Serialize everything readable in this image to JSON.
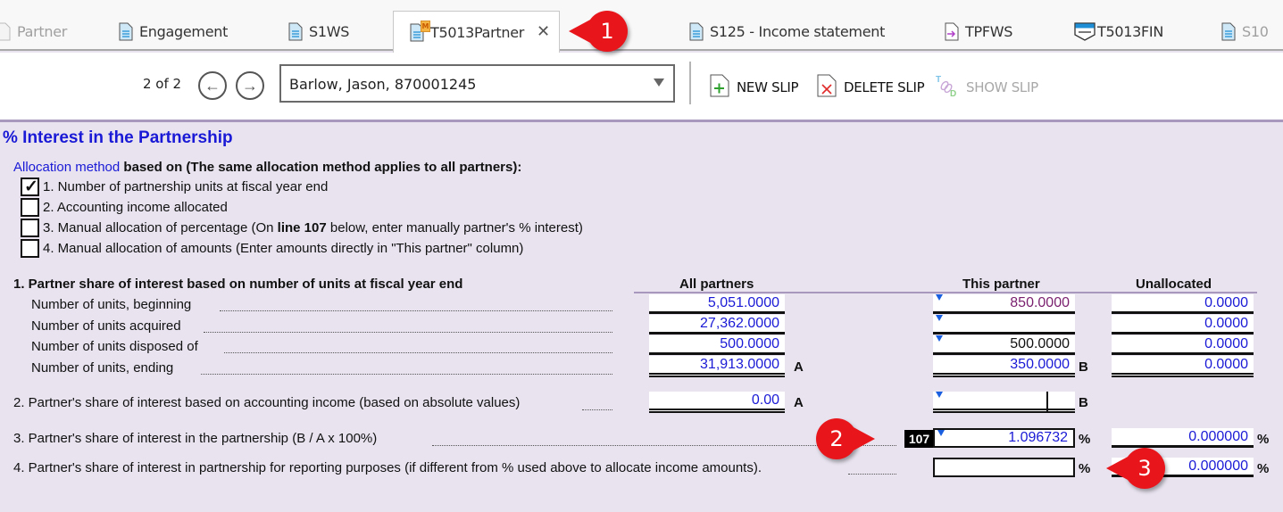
{
  "tabs": [
    {
      "label": "Partner",
      "icon": "document-icon",
      "state": "faded"
    },
    {
      "label": "Engagement",
      "icon": "document-icon",
      "state": "normal"
    },
    {
      "label": "S1WS",
      "icon": "document-icon",
      "state": "normal"
    },
    {
      "label": "T5013Partner",
      "icon": "document-icon",
      "badge": "M",
      "state": "active",
      "close": "✕"
    },
    {
      "label": "S125 - Income statement",
      "icon": "document-icon",
      "state": "normal"
    },
    {
      "label": "TPFWS",
      "icon": "transfer-document-icon",
      "state": "normal"
    },
    {
      "label": "T5013FIN",
      "icon": "slip-form-icon",
      "state": "normal"
    },
    {
      "label": "S10",
      "icon": "document-icon",
      "state": "faded"
    }
  ],
  "toolbar": {
    "pager": "2 of 2",
    "prev_symbol": "←",
    "next_symbol": "→",
    "selected_partner": "Barlow, Jason, 870001245",
    "new_slip": "NEW SLIP",
    "delete_slip": "DELETE SLIP",
    "show_slip": "SHOW SLIP"
  },
  "form": {
    "title": "% Interest in the Partnership",
    "allocation_prefix": "Allocation method",
    "allocation_suffix": " based on (The same allocation method applies to all partners):",
    "options": [
      {
        "label": "1. Number of partnership units at fiscal year end",
        "checked": true
      },
      {
        "label": "2. Accounting income allocated",
        "checked": false
      },
      {
        "label_pre": "3. Manual allocation of percentage (On ",
        "label_bold": "line 107",
        "label_post": " below, enter manually partner's % interest)",
        "checked": false
      },
      {
        "label": "4. Manual allocation of amounts (Enter amounts directly in \"This partner\" column)",
        "checked": false
      }
    ],
    "check_mark": "✓",
    "section1": {
      "title": "1. Partner share of interest based on number of units at fiscal year end",
      "columns": [
        "All partners",
        "This partner",
        "Unallocated"
      ],
      "rows": [
        {
          "label": "Number of units, beginning",
          "all": "5,051.0000",
          "this": "850.0000",
          "unallocated": "0.0000"
        },
        {
          "label": "Number of units acquired",
          "all": "27,362.0000",
          "this": "",
          "unallocated": "0.0000"
        },
        {
          "label": "Number of units disposed of",
          "all": "500.0000",
          "this": "500.0000",
          "unallocated": "0.0000"
        },
        {
          "label": "Number of units, ending",
          "all": "31,913.0000",
          "this": "350.0000",
          "unallocated": "0.0000"
        }
      ],
      "all_letter": "A",
      "this_letter": "B"
    },
    "line2": {
      "label": "2. Partner's share of interest based on accounting income (based on absolute values)",
      "all": "0.00",
      "this": "",
      "all_letter": "A",
      "this_letter": "B"
    },
    "line3": {
      "label": "3. Partner's share of interest in the partnership (B / A x 100%)",
      "line_no": "107",
      "this": "1.096732",
      "unallocated": "0.000000",
      "unit": "%"
    },
    "line4": {
      "label": "4. Partner's share of interest in partnership for reporting purposes (if different from % used above to allocate income amounts).",
      "this": "",
      "unallocated": "0.000000",
      "unit": "%"
    }
  },
  "callouts": [
    "1",
    "2",
    "3"
  ],
  "colors": {
    "accent_blue": "#1a1ad6",
    "callout_red": "#e8151b",
    "form_bg": "#e8e3ef",
    "rule_purple": "#a898bd"
  }
}
